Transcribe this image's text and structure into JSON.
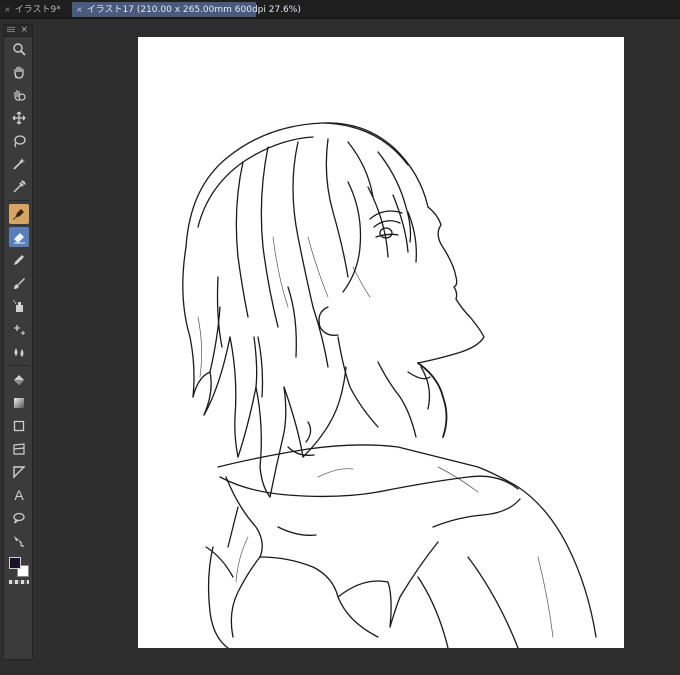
{
  "tabs": [
    {
      "label": "イラスト9*",
      "active": false
    },
    {
      "label": "イラスト17 (210.00 x 265.00mm 600dpi 27.6%)",
      "active": true
    }
  ],
  "toolbox": {
    "close_glyph": "×",
    "tools": [
      {
        "name": "zoom-icon",
        "active": false
      },
      {
        "name": "hand-icon",
        "active": false
      },
      {
        "name": "rotate-view-icon",
        "active": false
      },
      {
        "name": "move-layer-icon",
        "active": false
      },
      {
        "name": "lasso-selection-icon",
        "active": false
      },
      {
        "name": "magic-wand-icon",
        "active": false
      },
      {
        "name": "eyedropper-icon",
        "active": false
      },
      {
        "name": "pen-icon",
        "active": true,
        "accent": "#d7a563"
      },
      {
        "name": "eraser-icon",
        "active": true,
        "accent": "#5b7db8"
      },
      {
        "name": "pencil-icon",
        "active": false
      },
      {
        "name": "brush-icon",
        "active": false
      },
      {
        "name": "airbrush-icon",
        "active": false
      },
      {
        "name": "decoration-icon",
        "active": false
      },
      {
        "name": "blend-icon",
        "active": false
      },
      {
        "name": "fill-bucket-icon",
        "active": false
      },
      {
        "name": "gradient-icon",
        "active": false
      },
      {
        "name": "rectangle-figure-icon",
        "active": false
      },
      {
        "name": "frame-border-icon",
        "active": false
      },
      {
        "name": "ruler-icon",
        "active": false
      },
      {
        "name": "text-icon",
        "active": false
      },
      {
        "name": "balloon-icon",
        "active": false
      },
      {
        "name": "correct-line-icon",
        "active": false
      }
    ],
    "text_tool_glyph": "A",
    "main_color": "#1b1326",
    "sub_color": "#ffffff"
  },
  "colors": {
    "workspace_bg": "#2e2e2e",
    "canvas_bg": "#ffffff",
    "ink": "#1a1a1a"
  }
}
